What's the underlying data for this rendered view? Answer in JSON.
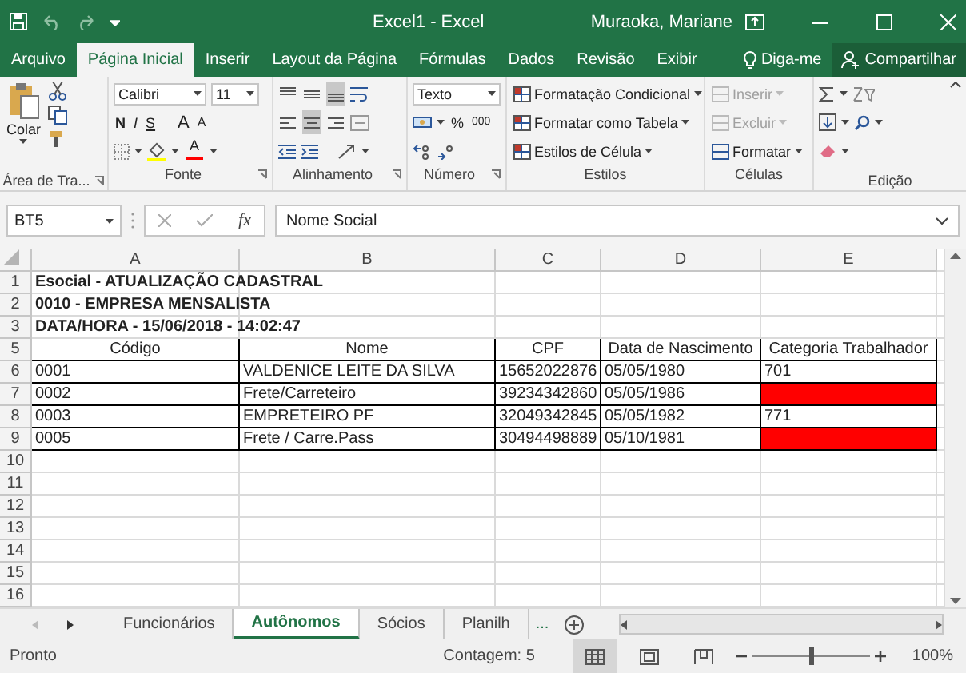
{
  "window": {
    "title": "Excel1  -  Excel",
    "user": "Muraoka, Mariane"
  },
  "ribbon_tabs": [
    {
      "label": "Arquivo",
      "selected": false
    },
    {
      "label": "Página Inicial",
      "selected": true
    },
    {
      "label": "Inserir",
      "selected": false
    },
    {
      "label": "Layout da Página",
      "selected": false
    },
    {
      "label": "Fórmulas",
      "selected": false
    },
    {
      "label": "Dados",
      "selected": false
    },
    {
      "label": "Revisão",
      "selected": false
    },
    {
      "label": "Exibir",
      "selected": false
    }
  ],
  "tell_me": "Diga-me",
  "share": "Compartilhar",
  "ribbon": {
    "clipboard": {
      "label": "Área de Tra...",
      "paste": "Colar"
    },
    "font": {
      "label": "Fonte",
      "font_name": "Calibri",
      "font_size": "11",
      "styles": [
        "N",
        "I",
        "S"
      ],
      "grow": "A",
      "shrink": "A",
      "color_letter": "A"
    },
    "alignment": {
      "label": "Alinhamento",
      "aligns": [
        {
          "kind": "top",
          "selected": false
        },
        {
          "kind": "middle",
          "selected": false
        },
        {
          "kind": "bottom",
          "selected": true
        },
        {
          "kind": "left",
          "selected": false
        },
        {
          "kind": "center",
          "selected": true
        },
        {
          "kind": "right",
          "selected": false
        }
      ]
    },
    "number": {
      "label": "Número",
      "format": "Texto",
      "percent": "%",
      "thousands": "000"
    },
    "styles": {
      "label": "Estilos",
      "items": [
        "Formatação Condicional",
        "Formatar como Tabela",
        "Estilos de Célula"
      ]
    },
    "cells": {
      "label": "Células",
      "items": [
        {
          "label": "Inserir",
          "disabled": true
        },
        {
          "label": "Excluir",
          "disabled": true
        },
        {
          "label": "Formatar",
          "disabled": false
        }
      ]
    },
    "editing": {
      "label": "Edição"
    }
  },
  "formula_bar": {
    "name_box": "BT5",
    "fx": "fx",
    "content": "Nome Social"
  },
  "sheet": {
    "columns": [
      "A",
      "B",
      "C",
      "D",
      "E"
    ],
    "rows": [
      {
        "number": "1",
        "kind": "title",
        "cells": [
          {
            "text": "Esocial - ATUALIZAÇÃO CADASTRAL"
          }
        ]
      },
      {
        "number": "2",
        "kind": "title",
        "cells": [
          {
            "text": "0010 - EMPRESA MENSALISTA"
          }
        ]
      },
      {
        "number": "3",
        "kind": "title",
        "cells": [
          {
            "text": "DATA/HORA - 15/06/2018 - 14:02:47"
          }
        ]
      },
      {
        "number": "5",
        "kind": "header",
        "cells": [
          {
            "text": "Código"
          },
          {
            "text": "Nome"
          },
          {
            "text": "CPF"
          },
          {
            "text": "Data de Nascimento"
          },
          {
            "text": "Categoria Trabalhador"
          }
        ]
      },
      {
        "number": "6",
        "kind": "data",
        "cells": [
          {
            "text": "0001"
          },
          {
            "text": "VALDENICE LEITE DA SILVA"
          },
          {
            "text": "15652022876"
          },
          {
            "text": "05/05/1980"
          },
          {
            "text": "701"
          }
        ]
      },
      {
        "number": "7",
        "kind": "data",
        "cells": [
          {
            "text": "0002"
          },
          {
            "text": "Frete/Carreteiro"
          },
          {
            "text": "39234342860"
          },
          {
            "text": "05/05/1986"
          },
          {
            "color": "#ff0000"
          }
        ]
      },
      {
        "number": "8",
        "kind": "data",
        "cells": [
          {
            "text": "0003"
          },
          {
            "text": "EMPRETEIRO PF"
          },
          {
            "text": "32049342845"
          },
          {
            "text": "05/05/1982"
          },
          {
            "text": "771"
          }
        ]
      },
      {
        "number": "9",
        "kind": "data",
        "cells": [
          {
            "text": "0005"
          },
          {
            "text": "Frete / Carre.Pass"
          },
          {
            "text": "30494498889"
          },
          {
            "text": "05/10/1981"
          },
          {
            "color": "#ff0000"
          }
        ]
      },
      {
        "number": "10",
        "kind": "empty"
      },
      {
        "number": "11",
        "kind": "empty"
      },
      {
        "number": "12",
        "kind": "empty"
      },
      {
        "number": "13",
        "kind": "empty"
      },
      {
        "number": "14",
        "kind": "empty"
      },
      {
        "number": "15",
        "kind": "empty"
      },
      {
        "number": "16",
        "kind": "empty"
      }
    ]
  },
  "sheet_tabs": {
    "tabs": [
      {
        "label": "Funcionários",
        "selected": false
      },
      {
        "label": "Autônomos",
        "selected": true
      },
      {
        "label": "Sócios",
        "selected": false
      },
      {
        "label": "Planilh",
        "selected": false
      }
    ],
    "more": "..."
  },
  "status_bar": {
    "status": "Pronto",
    "count": "Contagem: 5",
    "views": [
      {
        "kind": "normal",
        "selected": true
      },
      {
        "kind": "page_layout",
        "selected": false
      },
      {
        "kind": "page_break",
        "selected": false
      }
    ],
    "zoom": {
      "level": 0.5,
      "label": "100%"
    }
  }
}
